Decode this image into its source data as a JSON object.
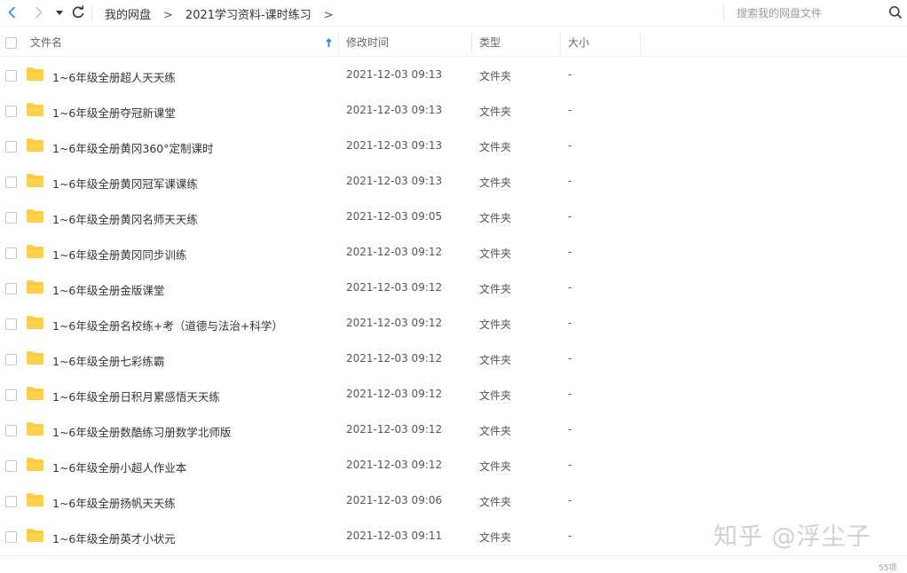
{
  "toolbar": {
    "breadcrumb": [
      "我的网盘",
      "2021学习资料-课时练习"
    ],
    "breadcrumb_separator": ">",
    "search_placeholder": "搜索我的网盘文件"
  },
  "columns": {
    "name": "文件名",
    "modified": "修改时间",
    "type": "类型",
    "size": "大小"
  },
  "files": [
    {
      "name": "1~6年级全册超人天天练",
      "modified": "2021-12-03 09:13",
      "type": "文件夹",
      "size": "-"
    },
    {
      "name": "1~6年级全册夺冠新课堂",
      "modified": "2021-12-03 09:13",
      "type": "文件夹",
      "size": "-"
    },
    {
      "name": "1~6年级全册黄冈360°定制课时",
      "modified": "2021-12-03 09:13",
      "type": "文件夹",
      "size": "-"
    },
    {
      "name": "1~6年级全册黄冈冠军课课练",
      "modified": "2021-12-03 09:13",
      "type": "文件夹",
      "size": "-"
    },
    {
      "name": "1~6年级全册黄冈名师天天练",
      "modified": "2021-12-03 09:05",
      "type": "文件夹",
      "size": "-"
    },
    {
      "name": "1~6年级全册黄冈同步训练",
      "modified": "2021-12-03 09:12",
      "type": "文件夹",
      "size": "-"
    },
    {
      "name": "1~6年级全册金版课堂",
      "modified": "2021-12-03 09:12",
      "type": "文件夹",
      "size": "-"
    },
    {
      "name": "1~6年级全册名校练+考（道德与法治+科学）",
      "modified": "2021-12-03 09:12",
      "type": "文件夹",
      "size": "-"
    },
    {
      "name": "1~6年级全册七彩练霸",
      "modified": "2021-12-03 09:12",
      "type": "文件夹",
      "size": "-"
    },
    {
      "name": "1~6年级全册日积月累感悟天天练",
      "modified": "2021-12-03 09:12",
      "type": "文件夹",
      "size": "-"
    },
    {
      "name": "1~6年级全册数酷练习册数学北师版",
      "modified": "2021-12-03 09:12",
      "type": "文件夹",
      "size": "-"
    },
    {
      "name": "1~6年级全册小超人作业本",
      "modified": "2021-12-03 09:12",
      "type": "文件夹",
      "size": "-"
    },
    {
      "name": "1~6年级全册扬帆天天练",
      "modified": "2021-12-03 09:06",
      "type": "文件夹",
      "size": "-"
    },
    {
      "name": "1~6年级全册英才小状元",
      "modified": "2021-12-03 09:11",
      "type": "文件夹",
      "size": "-"
    }
  ],
  "footer": {
    "count": "55项"
  },
  "watermark": "知乎 @浮尘子",
  "colors": {
    "folder": "#FFD04A",
    "accent": "#2E8AF0"
  }
}
